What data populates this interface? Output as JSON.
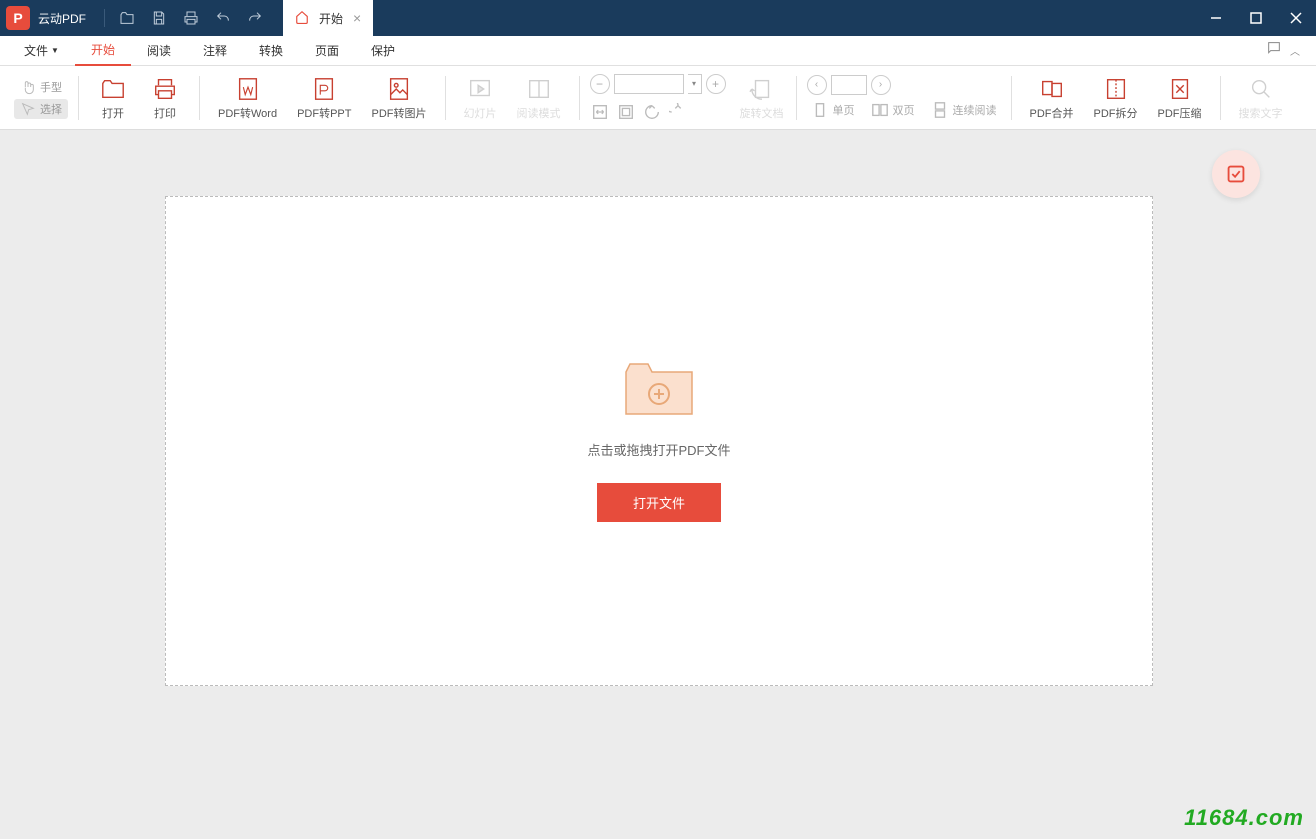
{
  "app": {
    "title": "云动PDF"
  },
  "tab": {
    "label": "开始"
  },
  "menu": {
    "file": "文件",
    "items": [
      "开始",
      "阅读",
      "注释",
      "转换",
      "页面",
      "保护"
    ],
    "active_index": 0
  },
  "ribbon": {
    "tools": {
      "hand": "手型",
      "select": "选择"
    },
    "open": "打开",
    "print": "打印",
    "pdf_to_word": "PDF转Word",
    "pdf_to_ppt": "PDF转PPT",
    "pdf_to_image": "PDF转图片",
    "slideshow": "幻灯片",
    "reading_mode": "阅读模式",
    "rotate_doc": "旋转文档",
    "single_page": "单页",
    "double_page": "双页",
    "continuous": "连续阅读",
    "pdf_merge": "PDF合并",
    "pdf_split": "PDF拆分",
    "pdf_compress": "PDF压缩",
    "search_text": "搜索文字"
  },
  "canvas": {
    "drop_text": "点击或拖拽打开PDF文件",
    "open_button": "打开文件"
  },
  "watermark": "11684.com"
}
